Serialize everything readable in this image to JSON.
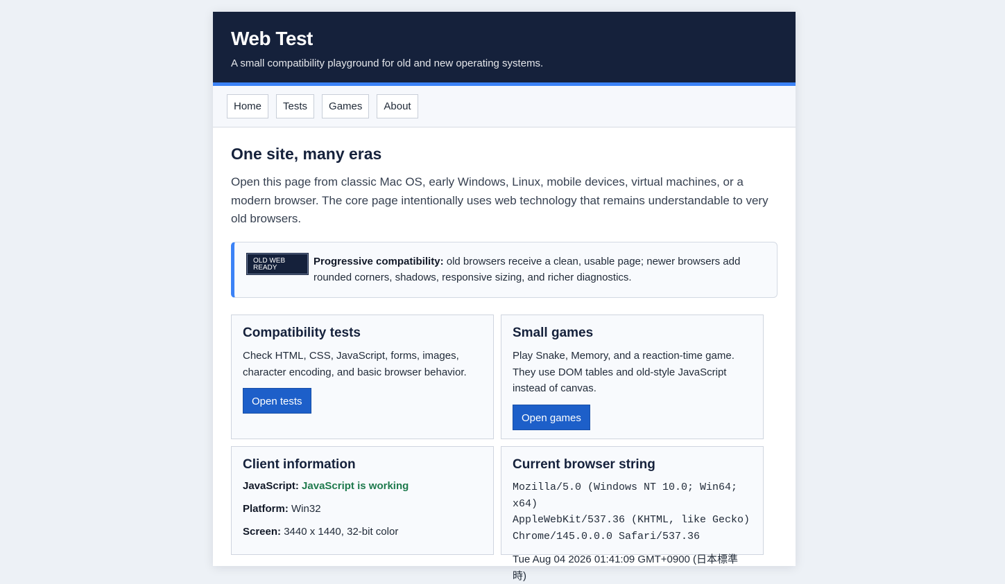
{
  "header": {
    "title": "Web Test",
    "subtitle": "A small compatibility playground for old and new operating systems."
  },
  "nav": {
    "items": [
      {
        "label": "Home"
      },
      {
        "label": "Tests"
      },
      {
        "label": "Games"
      },
      {
        "label": "About"
      }
    ]
  },
  "main": {
    "heading": "One site, many eras",
    "intro": "Open this page from classic Mac OS, early Windows, Linux, mobile devices, virtual machines, or a modern browser. The core page intentionally uses web technology that remains understandable to very old browsers."
  },
  "notice": {
    "badge_line1": "OLD WEB",
    "badge_line2": "READY",
    "bold": "Progressive compatibility:",
    "text": "old browsers receive a clean, usable page; newer browsers add rounded corners, shadows, responsive sizing, and richer diagnostics."
  },
  "cards": {
    "tests": {
      "title": "Compatibility tests",
      "text": "Check HTML, CSS, JavaScript, forms, images, character encoding, and basic browser behavior.",
      "button": "Open tests"
    },
    "games": {
      "title": "Small games",
      "text": "Play Snake, Memory, and a reaction-time game. They use DOM tables and old-style JavaScript instead of canvas.",
      "button": "Open games"
    },
    "client": {
      "title": "Client information",
      "js_label": "JavaScript:",
      "js_value": "JavaScript is working",
      "platform_label": "Platform:",
      "platform_value": "Win32",
      "screen_label": "Screen:",
      "screen_value": "3440 x 1440, 32-bit color"
    },
    "browser": {
      "title": "Current browser string",
      "ua_line1": "Mozilla/5.0 (Windows NT 10.0; Win64; x64)",
      "ua_line2": "AppleWebKit/537.36 (KHTML, like Gecko)",
      "ua_line3": "Chrome/145.0.0.0 Safari/537.36",
      "timestamp": "Tue Aug 04 2026 01:41:09 GMT+0900 (日本標準時)"
    }
  },
  "colors": {
    "header_bg": "#15213b",
    "accent": "#3b82f6",
    "button": "#1d5fc9",
    "success": "#1f7a4d"
  }
}
